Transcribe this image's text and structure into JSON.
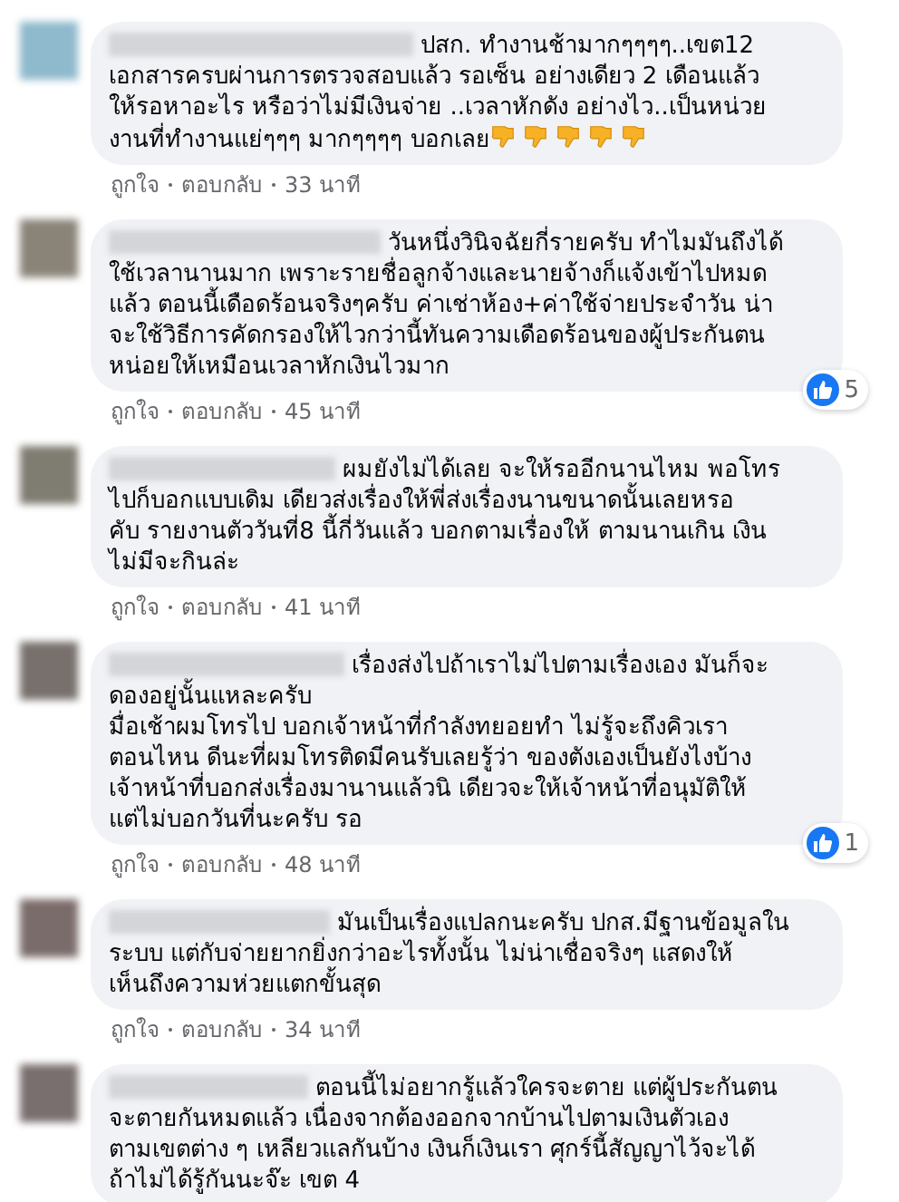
{
  "comments": [
    {
      "lines": [
        "ปสก. ทำงานช้ามากๆๆๆๆ..เขต12",
        "เอกสารครบผ่านการตรวจสอบแล้ว รอเซ็น อย่างเดียว 2 เดือนแล้ว",
        "ให้รอหาอะไร หรือว่าไม่มีเงินจ่าย ..เวลาหักดัง อย่างไว..เป็นหน่วย",
        "งานที่ทำงานแย่ๆๆๆ มากๆๆๆๆ บอกเลย"
      ],
      "emojis": [
        {
          "kind": "thumbs-down"
        },
        {
          "kind": "thumbs-down"
        },
        {
          "kind": "thumbs-down"
        },
        {
          "kind": "thumbs-down"
        },
        {
          "kind": "thumbs-down"
        }
      ],
      "actions": [
        "ถูกใจ",
        "ตอบกลับ",
        "33 นาที"
      ]
    },
    {
      "lines": [
        "วันหนึ่งวินิจฉัยกี่รายครับ ทำไมมันถึงได้",
        "ใช้เวลานานมาก เพราะรายชื่อลูกจ้างและนายจ้างก็แจ้งเข้าไปหมด",
        "แล้ว ตอนนี้เดือดร้อนจริงๆครับ ค่าเช่าห้อง+ค่าใช้จ่ายประจำวัน น่า",
        "จะใช้วิธีการคัดกรองให้ไวกว่านี้ทันความเดือดร้อนของผู้ประกันตน",
        "หน่อยให้เหมือนเวลาหักเงินไวมาก"
      ],
      "reactions": "5",
      "actions": [
        "ถูกใจ",
        "ตอบกลับ",
        "45 นาที"
      ]
    },
    {
      "lines": [
        "ผมยังไม่ได้เลย จะให้รออีกนานไหม พอโทร",
        "ไปก็บอกแบบเดิม เดียวส่งเรื่องให้พี่ส่งเรื่องนานขนาดนั้นเลยหรอ",
        "คับ รายงานตัววันที่8 นี้กี่วันแล้ว บอกตามเรื่องให้ ตามนานเกิน เงิน",
        "ไม่มีจะกินล่ะ"
      ],
      "actions": [
        "ถูกใจ",
        "ตอบกลับ",
        "41 นาที"
      ]
    },
    {
      "lines": [
        "เรื่องส่งไปถ้าเราไม่ไปตามเรื่องเอง มันก็จะ",
        "ดองอยู่นั้นแหละครับ",
        "มื่อเช้าผมโทรไป บอกเจ้าหน้าที่กำลังทยอยทำ ไม่รู้จะถึงคิวเรา",
        "ตอนไหน ดีนะที่ผมโทรติดมีคนรับเลยรู้ว่า ของตังเองเป็นยังไงบ้าง",
        "เจ้าหน้าที่บอกส่งเรื่องมานานแล้วนิ เดียวจะให้เจ้าหน้าที่อนุมัติให้",
        "แต่ไม่บอกวันที่นะครับ รอ"
      ],
      "reactions": "1",
      "actions": [
        "ถูกใจ",
        "ตอบกลับ",
        "48 นาที"
      ]
    },
    {
      "lines": [
        "มันเป็นเรื่องแปลกนะครับ ปกส.มีฐานข้อมูลใน",
        "ระบบ แต่กับจ่ายยากยิ่งกว่าอะไรทั้งนั้น ไม่น่าเชื่อจริงๆ แสดงให้",
        "เห็นถึงความห่วยแตกขั้นสุด"
      ],
      "actions": [
        "ถูกใจ",
        "ตอบกลับ",
        "34 นาที"
      ]
    },
    {
      "lines": [
        "ตอนนี้ไม่อยากรู้แล้วใครจะตาย แต่ผู้ประกันตน",
        "จะตายกันหมดแล้ว เนื่องจากต้องออกจากบ้านไปตามเงินตัวเอง",
        "ตามเขตต่าง ๆ เหลียวแลกันบ้าง เงินก็เงินเรา ศุกร์นี้สัญญาไว้จะได้",
        "ถ้าไม่ได้รู้กันนะจ๊ะ เขต 4"
      ]
    }
  ]
}
